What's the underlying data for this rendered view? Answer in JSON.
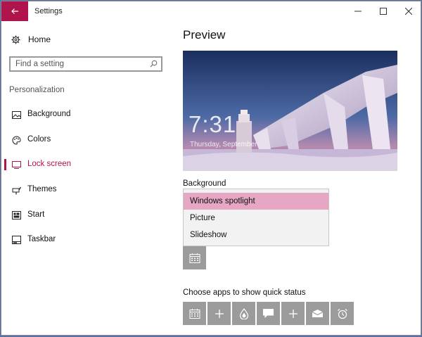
{
  "window": {
    "title": "Settings",
    "accent": "#b0144c"
  },
  "nav": {
    "home": "Home",
    "search_placeholder": "Find a setting",
    "section": "Personalization",
    "items": [
      {
        "label": "Background",
        "icon": "picture-icon"
      },
      {
        "label": "Colors",
        "icon": "palette-icon"
      },
      {
        "label": "Lock screen",
        "icon": "lock-screen-icon",
        "active": true
      },
      {
        "label": "Themes",
        "icon": "brush-icon"
      },
      {
        "label": "Start",
        "icon": "start-icon"
      },
      {
        "label": "Taskbar",
        "icon": "taskbar-icon"
      }
    ]
  },
  "content": {
    "preview_title": "Preview",
    "clock": "7:31",
    "date": "Thursday, September",
    "background_label": "Background",
    "options": [
      "Windows spotlight",
      "Picture",
      "Slideshow"
    ],
    "selected_option": "Windows spotlight",
    "quick_status_label": "Choose apps to show quick status",
    "quick_tiles": [
      "calendar-icon",
      "plus-icon",
      "drop-icon",
      "chat-icon",
      "plus-icon",
      "mail-icon",
      "alarm-icon"
    ]
  }
}
